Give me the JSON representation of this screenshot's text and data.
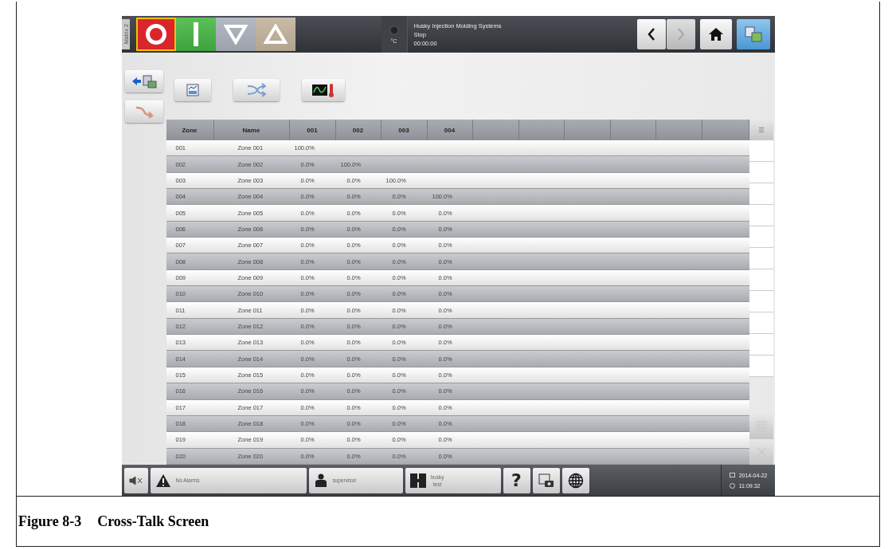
{
  "screen": {
    "tab_label": "Matrix 2",
    "status": {
      "unit": "°C",
      "title": "Husky Injection Molding Systems",
      "state": "Stop",
      "timer": "00:00:00"
    },
    "table": {
      "columns": [
        "Zone",
        "Name",
        "001",
        "002",
        "003",
        "004"
      ],
      "rows": [
        {
          "cells": [
            "001",
            "Zone 001",
            "100.0%"
          ]
        },
        {
          "cells": [
            "002",
            "Zone 002",
            "0.0%",
            "100.0%"
          ]
        },
        {
          "cells": [
            "003",
            "Zone 003",
            "0.0%",
            "0.0%",
            "100.0%"
          ]
        },
        {
          "cells": [
            "004",
            "Zone 004",
            "0.0%",
            "0.0%",
            "0.0%",
            "100.0%"
          ]
        },
        {
          "cells": [
            "005",
            "Zone 005",
            "0.0%",
            "0.0%",
            "0.0%",
            "0.0%"
          ]
        },
        {
          "cells": [
            "006",
            "Zone 006",
            "0.0%",
            "0.0%",
            "0.0%",
            "0.0%"
          ]
        },
        {
          "cells": [
            "007",
            "Zone 007",
            "0.0%",
            "0.0%",
            "0.0%",
            "0.0%"
          ]
        },
        {
          "cells": [
            "008",
            "Zone 008",
            "0.0%",
            "0.0%",
            "0.0%",
            "0.0%"
          ]
        },
        {
          "cells": [
            "009",
            "Zone 009",
            "0.0%",
            "0.0%",
            "0.0%",
            "0.0%"
          ]
        },
        {
          "cells": [
            "010",
            "Zone 010",
            "0.0%",
            "0.0%",
            "0.0%",
            "0.0%"
          ]
        },
        {
          "cells": [
            "011",
            "Zone 011",
            "0.0%",
            "0.0%",
            "0.0%",
            "0.0%"
          ]
        },
        {
          "cells": [
            "012",
            "Zone 012",
            "0.0%",
            "0.0%",
            "0.0%",
            "0.0%"
          ]
        },
        {
          "cells": [
            "013",
            "Zone 013",
            "0.0%",
            "0.0%",
            "0.0%",
            "0.0%"
          ]
        },
        {
          "cells": [
            "014",
            "Zone 014",
            "0.0%",
            "0.0%",
            "0.0%",
            "0.0%"
          ]
        },
        {
          "cells": [
            "015",
            "Zone 015",
            "0.0%",
            "0.0%",
            "0.0%",
            "0.0%"
          ]
        },
        {
          "cells": [
            "016",
            "Zone 016",
            "0.0%",
            "0.0%",
            "0.0%",
            "0.0%"
          ]
        },
        {
          "cells": [
            "017",
            "Zone 017",
            "0.0%",
            "0.0%",
            "0.0%",
            "0.0%"
          ]
        },
        {
          "cells": [
            "018",
            "Zone 018",
            "0.0%",
            "0.0%",
            "0.0%",
            "0.0%"
          ]
        },
        {
          "cells": [
            "019",
            "Zone 019",
            "0.0%",
            "0.0%",
            "0.0%",
            "0.0%"
          ]
        },
        {
          "cells": [
            "020",
            "Zone 020",
            "0.0%",
            "0.0%",
            "0.0%",
            "0.0%"
          ]
        }
      ]
    },
    "status_bar": {
      "alarms": "No Alarms",
      "user": "supervisor",
      "mold_line1": "husky",
      "mold_line2": "test",
      "help": "?",
      "date": "2014-04-22",
      "time": "11:09:32"
    }
  },
  "caption": {
    "number": "Figure 8-3",
    "title": "Cross-Talk Screen"
  }
}
